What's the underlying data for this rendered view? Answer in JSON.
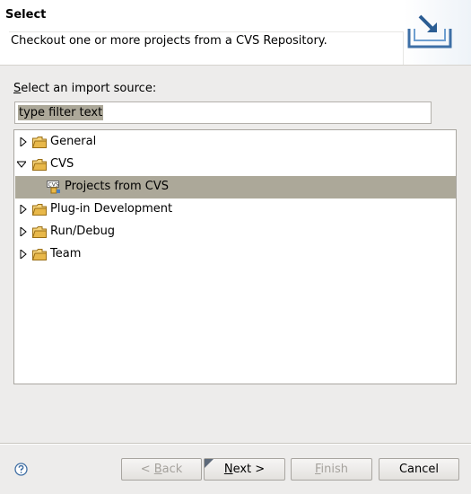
{
  "header": {
    "title": "Select",
    "description": "Checkout one or more projects from a CVS Repository.",
    "icon": "import-wizard-icon"
  },
  "source": {
    "label_mnemonic": "S",
    "label_rest": "elect an import source:",
    "filter_value": "type filter text"
  },
  "tree": {
    "items": [
      {
        "label": "General",
        "expanded": false
      },
      {
        "label": "CVS",
        "expanded": true
      },
      {
        "label": "Projects from CVS",
        "child": true,
        "selected": true,
        "icon_text": "CVS"
      },
      {
        "label": "Plug-in Development",
        "expanded": false
      },
      {
        "label": "Run/Debug",
        "expanded": false
      },
      {
        "label": "Team",
        "expanded": false
      }
    ]
  },
  "buttons": {
    "back_prefix": "< ",
    "back_mnemonic": "B",
    "back_rest": "ack",
    "next_mnemonic": "N",
    "next_rest": "ext >",
    "finish_mnemonic": "F",
    "finish_rest": "inish",
    "cancel": "Cancel"
  },
  "help": {
    "icon": "help-icon"
  },
  "colors": {
    "selection": "#aca899",
    "background": "#edeceb",
    "folder": "#e8b84a"
  }
}
